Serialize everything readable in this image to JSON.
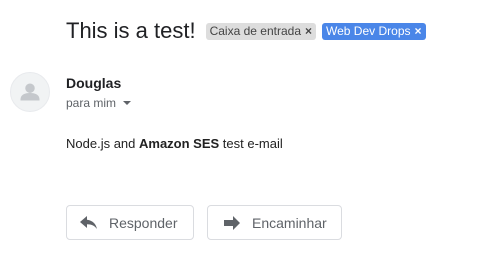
{
  "email": {
    "subject": "This is a test!",
    "labels": [
      {
        "name": "Caixa de entrada",
        "remove": "×",
        "color": "#dddddd",
        "text_color": "#444444"
      },
      {
        "name": "Web Dev Drops",
        "remove": "×",
        "color": "#4a86e8",
        "text_color": "#ffffff"
      }
    ],
    "sender": {
      "name": "Douglas",
      "recipient_text": "para mim"
    },
    "body": {
      "part1": "Node.js and ",
      "bold": "Amazon SES",
      "part2": " test e-mail"
    },
    "actions": {
      "reply_label": "Responder",
      "forward_label": "Encaminhar"
    }
  },
  "icons": {
    "avatar": "person-icon",
    "recipient_caret": "caret-down-icon",
    "reply": "reply-arrow-icon",
    "forward": "forward-arrow-icon"
  }
}
